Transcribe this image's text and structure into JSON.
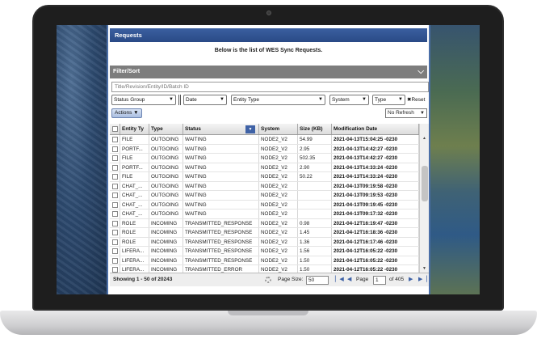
{
  "app": {
    "title": "Requests",
    "subtitle": "Below is the list of WES Sync Requests."
  },
  "filter": {
    "label": "Filter/Sort",
    "search_placeholder": "Title/Revision/Entity/ID/Batch ID",
    "status_group": "Status Group",
    "date": "Date",
    "entity_type": "Entity Type",
    "system": "System",
    "type": "Type",
    "reset": "✖Reset"
  },
  "toolbar": {
    "actions": "Actions ▼",
    "refresh": "No Refresh"
  },
  "columns": [
    "Entity Ty",
    "Type",
    "Status",
    "System",
    "Size (KB)",
    "Modification Date"
  ],
  "rows": [
    [
      "FILE",
      "OUTGOING",
      "WAITING",
      "NODE2_V2",
      "54.99",
      "2021-04-13T15:04:25 -0230"
    ],
    [
      "PORTF...",
      "OUTGOING",
      "WAITING",
      "NODE2_V2",
      "2.95",
      "2021-04-13T14:42:27 -0230"
    ],
    [
      "FILE",
      "OUTGOING",
      "WAITING",
      "NODE2_V2",
      "502.35",
      "2021-04-13T14:42:27 -0230"
    ],
    [
      "PORTF...",
      "OUTGOING",
      "WAITING",
      "NODE2_V2",
      "2.90",
      "2021-04-13T14:33:24 -0230"
    ],
    [
      "FILE",
      "OUTGOING",
      "WAITING",
      "NODE2_V2",
      "50.22",
      "2021-04-13T14:33:24 -0230"
    ],
    [
      "CHAT_...",
      "OUTGOING",
      "WAITING",
      "NODE2_V2",
      "",
      "2021-04-13T09:19:58 -0230"
    ],
    [
      "CHAT_...",
      "OUTGOING",
      "WAITING",
      "NODE2_V2",
      "",
      "2021-04-13T09:19:53 -0230"
    ],
    [
      "CHAT_...",
      "OUTGOING",
      "WAITING",
      "NODE2_V2",
      "",
      "2021-04-13T09:19:45 -0230"
    ],
    [
      "CHAT_...",
      "OUTGOING",
      "WAITING",
      "NODE2_V2",
      "",
      "2021-04-13T09:17:32 -0230"
    ],
    [
      "ROLE",
      "INCOMING",
      "TRANSMITTED_RESPONSE",
      "NODE2_V2",
      "0.98",
      "2021-04-12T16:19:47 -0230"
    ],
    [
      "ROLE",
      "INCOMING",
      "TRANSMITTED_RESPONSE",
      "NODE2_V2",
      "1.45",
      "2021-04-12T16:18:36 -0230"
    ],
    [
      "ROLE",
      "INCOMING",
      "TRANSMITTED_RESPONSE",
      "NODE2_V2",
      "1.36",
      "2021-04-12T16:17:46 -0230"
    ],
    [
      "LIFERA...",
      "INCOMING",
      "TRANSMITTED_RESPONSE",
      "NODE2_V2",
      "1.56",
      "2021-04-12T16:05:22 -0230"
    ],
    [
      "LIFERA...",
      "INCOMING",
      "TRANSMITTED_RESPONSE",
      "NODE2_V2",
      "1.50",
      "2021-04-12T16:05:22 -0230"
    ],
    [
      "LIFERA...",
      "INCOMING",
      "TRANSMITTED_ERROR",
      "NODE2_V2",
      "1.50",
      "2021-04-12T16:05:22 -0230"
    ]
  ],
  "footer": {
    "showing": "Showing 1 - 50 of 20243",
    "page_size_label": "Page Size:",
    "page_size": "50",
    "page_label": "Page",
    "page": "1",
    "of_pages": "of 405",
    "nav_first": "▏◀",
    "nav_prev": "◀",
    "nav_next": "▶",
    "nav_last": "▶▕"
  },
  "icons": {
    "collapse": "chevron-down-icon",
    "dropdown": "caret-down-icon",
    "column_menu": "column-menu-icon",
    "loading": "spinner-icon"
  },
  "colors": {
    "title_bar": "#2a4a86",
    "filter_bar": "#7d7d7d",
    "accent": "#3f62a6"
  }
}
